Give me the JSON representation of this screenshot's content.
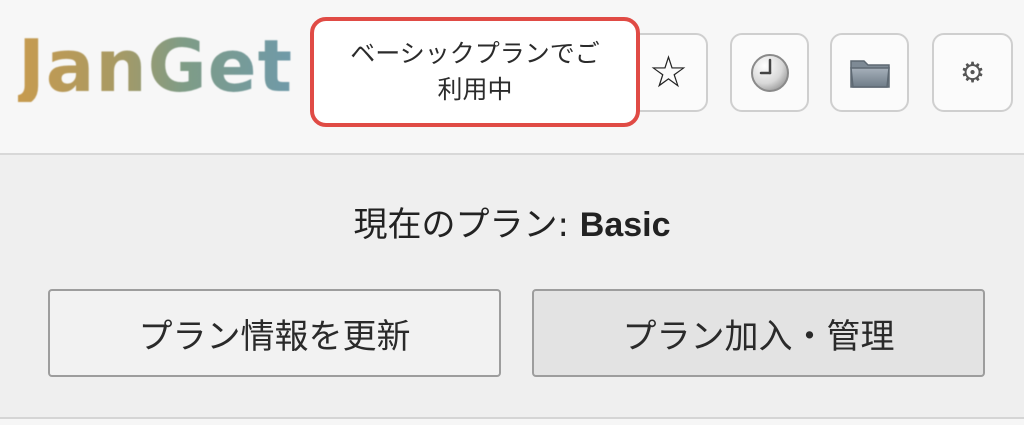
{
  "header": {
    "logo_text": "JanGet",
    "plan_status_text": "ベーシックプランでご\n利用中",
    "toolbar_icons": [
      {
        "name": "star-icon",
        "glyph": "☆"
      },
      {
        "name": "history-clock-icon"
      },
      {
        "name": "folder-icon"
      },
      {
        "name": "gear-icon",
        "glyph": "⚙"
      }
    ],
    "highlight_color": "#e04b45"
  },
  "main": {
    "current_plan_label": "現在のプラン: ",
    "current_plan_value": "Basic",
    "refresh_button_label": "プラン情報を更新",
    "manage_button_label": "プラン加入・管理"
  }
}
